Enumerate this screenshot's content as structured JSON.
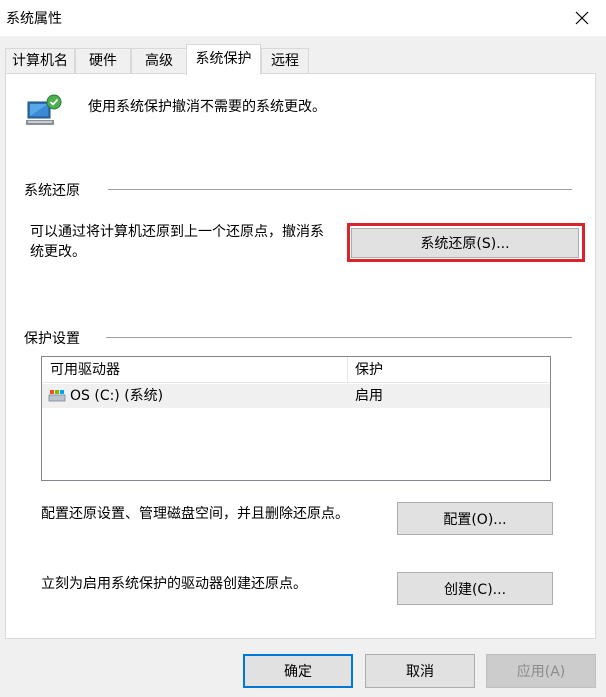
{
  "window": {
    "title": "系统属性"
  },
  "tabs": [
    {
      "label": "计算机名"
    },
    {
      "label": "硬件"
    },
    {
      "label": "高级"
    },
    {
      "label": "系统保护",
      "active": true
    },
    {
      "label": "远程"
    }
  ],
  "intro": {
    "icon": "computer-shield-icon",
    "text": "使用系统保护撤消不需要的系统更改。"
  },
  "restore_section": {
    "label": "系统还原",
    "description_line1": "可以通过将计算机还原到上一个还原点，撤消系",
    "description_line2": "统更改。",
    "button_label": "系统还原(S)...",
    "highlight_color": "#d9232d"
  },
  "protection_section": {
    "label": "保护设置",
    "columns": [
      "可用驱动器",
      "保护"
    ],
    "drives": [
      {
        "name": "OS (C:) (系统)",
        "protection": "启用",
        "icon": "drive-icon"
      }
    ],
    "configure_text": "配置还原设置、管理磁盘空间，并且删除还原点。",
    "configure_button": "配置(O)...",
    "create_text": "立刻为启用系统保护的驱动器创建还原点。",
    "create_button": "创建(C)..."
  },
  "footer": {
    "ok": "确定",
    "cancel": "取消",
    "apply": "应用(A)"
  }
}
